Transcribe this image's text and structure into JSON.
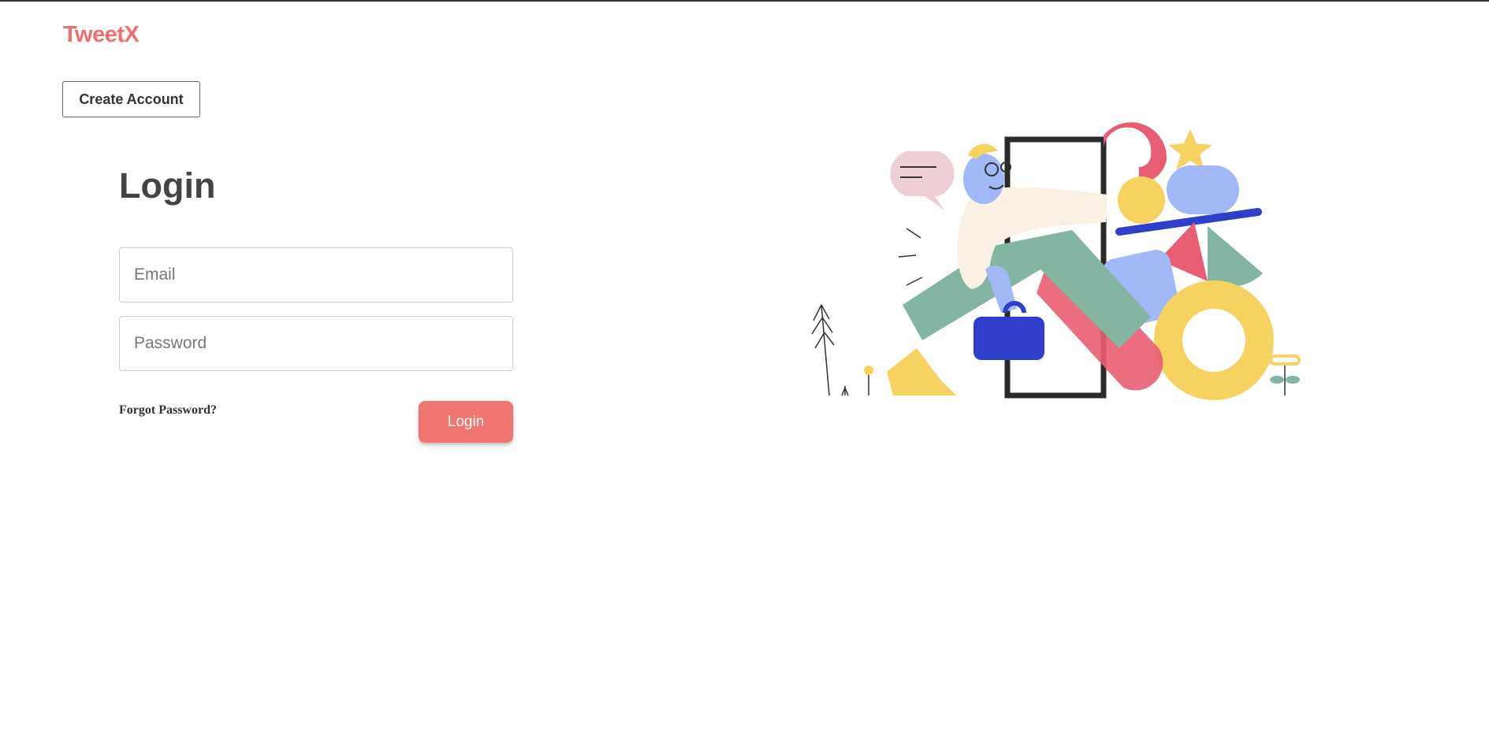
{
  "header": {
    "brand": "TweetX",
    "create_account_label": "Create Account"
  },
  "login": {
    "title": "Login",
    "email_placeholder": "Email",
    "email_value": "",
    "password_placeholder": "Password",
    "password_value": "",
    "forgot_label": "Forgot Password?",
    "submit_label": "Login"
  },
  "colors": {
    "brand": "#ef6f6c",
    "button": "#f07470",
    "illustration_green": "#83b5a3",
    "illustration_blue": "#a2b9f8",
    "illustration_yellow": "#f6d261",
    "illustration_pink": "#e95d72",
    "illustration_navy": "#2f3fcb"
  },
  "icons": {
    "illustration": "person-walking-through-door-illustration"
  }
}
